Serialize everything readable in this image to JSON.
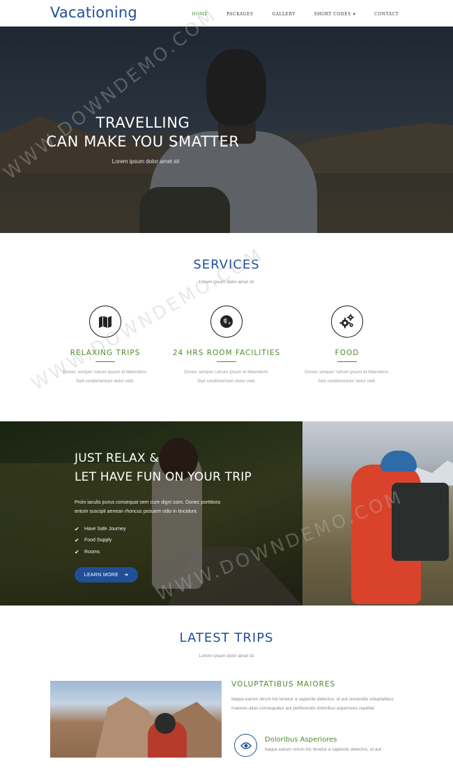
{
  "header": {
    "logo": "Vacationing",
    "nav": [
      {
        "label": "HOME",
        "active": true
      },
      {
        "label": "PACKAGES",
        "active": false
      },
      {
        "label": "GALLERY",
        "active": false
      },
      {
        "label": "SHORT CODES",
        "active": false,
        "dropdown": true
      },
      {
        "label": "CONTACT",
        "active": false
      }
    ]
  },
  "hero": {
    "title_line1": "TRAVELLING",
    "title_line2": "CAN MAKE YOU SMATTER",
    "subtitle": "Lorem ipsum dolor amet sit"
  },
  "services": {
    "title": "SERVICES",
    "subtitle": "Lorem ipsum dolor amet sit",
    "items": [
      {
        "icon": "map-icon",
        "name": "RELAXING TRIPS",
        "desc1": "Donec semper rutrum ipsum et bibendum.",
        "desc2": "Sed condimentum dolor velit."
      },
      {
        "icon": "globe-icon",
        "name": "24 HRS ROOM FACILITIES",
        "desc1": "Donec semper rutrum ipsum et bibendum.",
        "desc2": "Sed condimentum dolor velit."
      },
      {
        "icon": "gears-icon",
        "name": "FOOD",
        "desc1": "Donec semper rutrum ipsum et bibendum.",
        "desc2": "Sed condimentum dolor velit."
      }
    ]
  },
  "relax": {
    "title_line1": "JUST RELAX &",
    "title_line2": "LET HAVE FUN ON YOUR TRIP",
    "text": "Proin iaculis purus consequat sem cure digni ssim. Donec porttitora entum suscipit aenean rhoncus posuere odio in tincidunt.",
    "list": [
      "Have Safe Journey",
      "Food Supply",
      "Rooms"
    ],
    "button": "LEARN MORE"
  },
  "latest": {
    "title": "LATEST TRIPS",
    "subtitle": "Lorem ipsum dolor amet sit",
    "trip_title": "VOLUPTATIBUS MAIORES",
    "trip_desc": "Itaque earum rerum hic tenetur a sapiente delectus, ut aut reiciendis voluptatibus maiores alias consequatur aut perferendis doloribus asperiores repellat.",
    "feature_icon": "eye-icon",
    "feature_title": "Doloribus Asperiores",
    "feature_desc": "Itaque earum rerum hic tenetur a sapiente delectus, ut aut ."
  },
  "watermark": "WWW.DOWNDEMO.COM",
  "colors": {
    "brand_blue": "#1f4f96",
    "accent_green": "#4e8a2a"
  }
}
